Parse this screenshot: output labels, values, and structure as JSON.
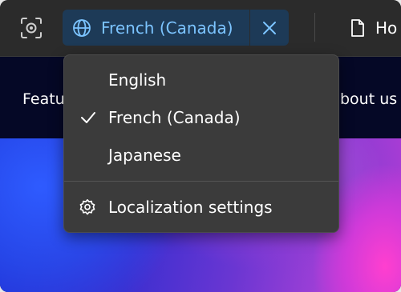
{
  "toolbar": {
    "locale": {
      "label": "French (Canada)"
    },
    "page": {
      "label": "Ho"
    }
  },
  "site": {
    "nav_left": "Featu",
    "nav_right": "bout us"
  },
  "dropdown": {
    "languages": [
      {
        "label": "English",
        "selected": false
      },
      {
        "label": "French (Canada)",
        "selected": true
      },
      {
        "label": "Japanese",
        "selected": false
      }
    ],
    "settings_label": "Localization settings"
  },
  "colors": {
    "accent": "#7cc4ff",
    "chip_bg": "#1d3a57",
    "menu_bg": "#3b3b3b",
    "toolbar_bg": "#2b2b2b"
  },
  "icons": {
    "preview": "preview-target-icon",
    "locale": "globe-icon",
    "close": "close-icon",
    "page": "page-icon",
    "check": "checkmark-icon",
    "settings": "gear-icon"
  }
}
